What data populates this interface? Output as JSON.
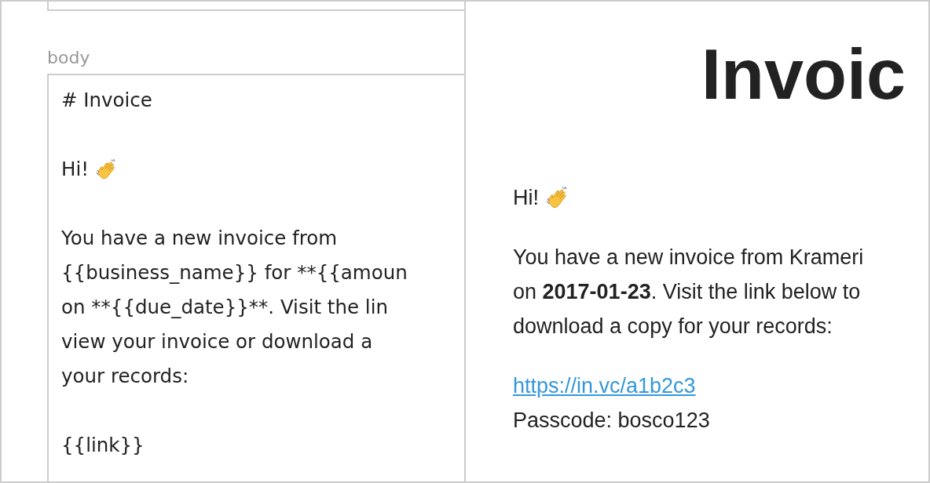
{
  "editor": {
    "label": "body",
    "blocks": [
      {
        "kind": "text",
        "lines": [
          "# Invoice"
        ]
      },
      {
        "kind": "greeting",
        "lines": [
          "Hi!"
        ]
      },
      {
        "kind": "text",
        "lines": [
          "You have a new invoice from",
          "{{business_name}} for **{{amoun",
          "on **{{due_date}}**. Visit the lin",
          "view your invoice or download a",
          "your records:"
        ]
      },
      {
        "kind": "text",
        "lines": [
          "{{link}}"
        ]
      }
    ]
  },
  "preview": {
    "title": "Invoic",
    "greeting": "Hi!",
    "paragraph": [
      "You have a new invoice from Krameri",
      "on **2017-01-23**. Visit the link below to",
      "download a copy for your records:"
    ],
    "link": "https://in.vc/a1b2c3",
    "passcode": "Passcode: bosco123"
  }
}
